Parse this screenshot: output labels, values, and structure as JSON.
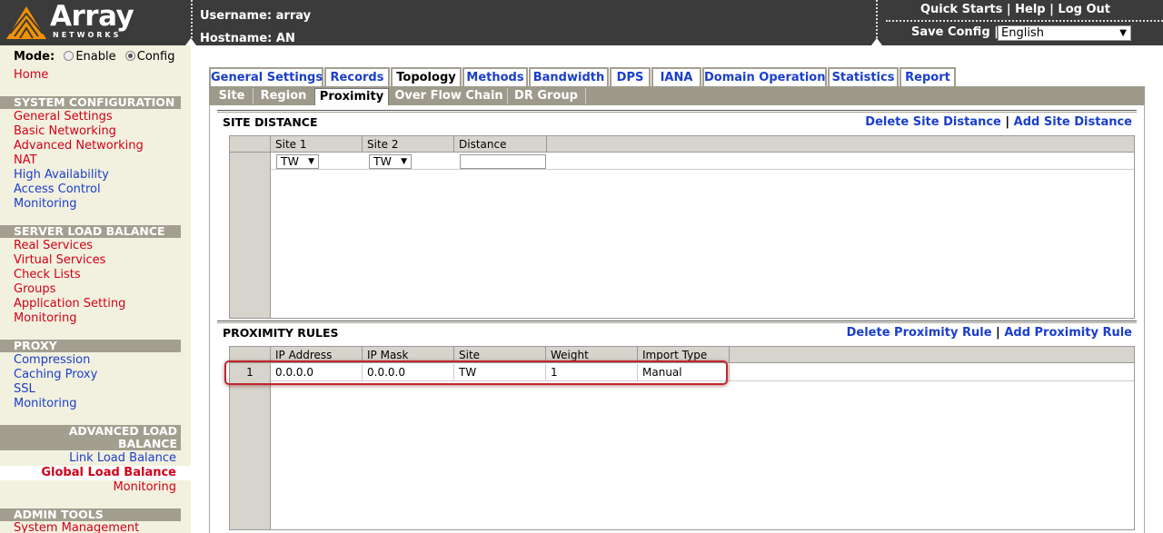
{
  "header": {
    "brand": "Array",
    "brand_sub": "NETWORKS",
    "username_label": "Username: array",
    "hostname_label": "Hostname: AN",
    "links": [
      "Quick Starts",
      "Help",
      "Log Out"
    ],
    "save_config": "Save Config",
    "language": "English"
  },
  "sidebar": {
    "mode_label": "Mode:",
    "mode_enable": "Enable",
    "mode_config": "Config",
    "home": "Home",
    "system_configuration": {
      "title": "SYSTEM CONFIGURATION",
      "items": [
        "General Settings",
        "Basic Networking",
        "Advanced Networking",
        "NAT",
        "High Availability",
        "Access Control",
        "Monitoring"
      ]
    },
    "server_load_balance": {
      "title": "SERVER LOAD BALANCE",
      "items": [
        "Real Services",
        "Virtual Services",
        "Check Lists",
        "Groups",
        "Application Setting",
        "Monitoring"
      ]
    },
    "proxy": {
      "title": "PROXY",
      "items": [
        "Compression",
        "Caching Proxy",
        "SSL",
        "Monitoring"
      ]
    },
    "advanced_load_balance": {
      "title_line1": "ADVANCED LOAD",
      "title_line2": "BALANCE",
      "items": [
        "Link Load Balance",
        "Global Load Balance",
        "Monitoring"
      ]
    },
    "admin_tools": {
      "title": "ADMIN TOOLS",
      "items": [
        "System Management"
      ]
    }
  },
  "tabs": [
    "General Settings",
    "Records",
    "Topology",
    "Methods",
    "Bandwidth",
    "DPS",
    "IANA",
    "Domain Operation",
    "Statistics",
    "Report"
  ],
  "subtabs": [
    "Site",
    "Region",
    "Proximity",
    "Over Flow Chain",
    "DR Group"
  ],
  "site_distance": {
    "title": "SITE DISTANCE",
    "delete_link": "Delete Site Distance",
    "add_link": "Add Site Distance",
    "columns": [
      "Site 1",
      "Site 2",
      "Distance"
    ],
    "site1_value": "TW",
    "site2_value": "TW",
    "distance_value": ""
  },
  "proximity_rules": {
    "title": "PROXIMITY RULES",
    "delete_link": "Delete Proximity Rule",
    "add_link": "Add Proximity Rule",
    "columns": [
      "IP Address",
      "IP Mask",
      "Site",
      "Weight",
      "Import Type"
    ],
    "rows": [
      {
        "num": "1",
        "cells": [
          "0.0.0.0",
          "0.0.0.0",
          "TW",
          "1",
          "Manual"
        ]
      }
    ]
  },
  "colors": {
    "header_bg": "#3b3b3b",
    "sidebar_bg": "#f2f0de",
    "section_head_bg": "#a39f90",
    "link_red": "#d0021b",
    "link_blue": "#1a3ecc",
    "highlight_red": "#c0262c"
  }
}
